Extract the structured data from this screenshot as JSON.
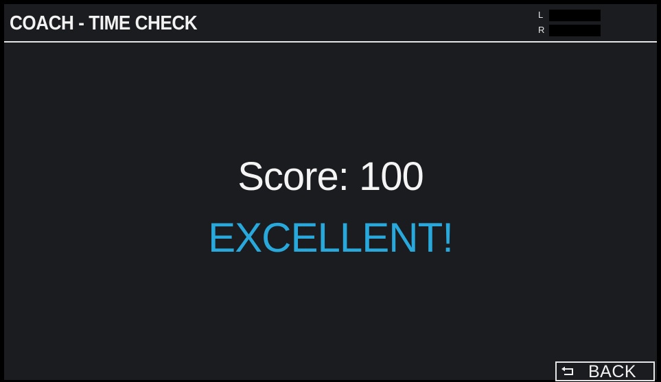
{
  "header": {
    "title": "COACH - TIME CHECK",
    "meter": {
      "left_label": "L",
      "right_label": "R"
    }
  },
  "result": {
    "score_label": "Score:",
    "score_value": "100",
    "rating": "EXCELLENT!"
  },
  "footer": {
    "back_label": "BACK",
    "back_icon": "return-arrow-icon"
  },
  "colors": {
    "background": "#1b1c20",
    "rating_accent": "#29a8db",
    "text": "#f4f4f4"
  }
}
